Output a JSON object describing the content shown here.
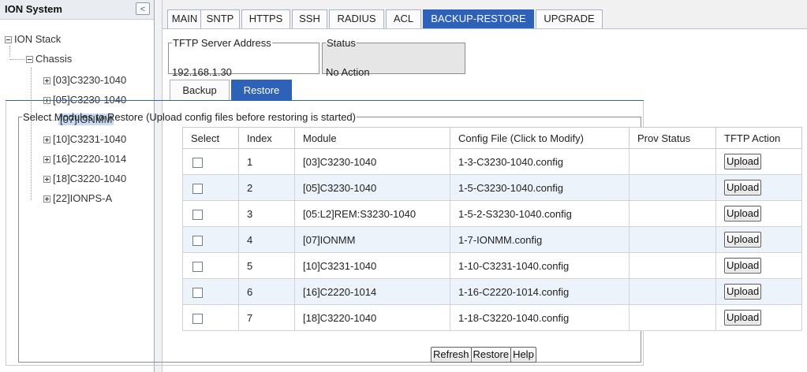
{
  "tree": {
    "title": "ION System",
    "collapse_glyph": "<",
    "root": "ION Stack",
    "chassis": "Chassis",
    "items": [
      {
        "label": "[03]C3230-1040",
        "expandable": true
      },
      {
        "label": "[05]C3230-1040",
        "expandable": true
      },
      {
        "label": "[07]IONMM",
        "expandable": false,
        "selected": true
      },
      {
        "label": "[10]C3231-1040",
        "expandable": true
      },
      {
        "label": "[16]C2220-1014",
        "expandable": true
      },
      {
        "label": "[18]C3220-1040",
        "expandable": true
      },
      {
        "label": "[22]IONPS-A",
        "expandable": true
      }
    ]
  },
  "tabs": [
    {
      "label": "MAIN"
    },
    {
      "label": "SNTP"
    },
    {
      "label": "HTTPS"
    },
    {
      "label": "SSH"
    },
    {
      "label": "RADIUS"
    },
    {
      "label": "ACL"
    },
    {
      "label": "BACKUP-RESTORE",
      "active": true
    },
    {
      "label": "UPGRADE"
    }
  ],
  "tftp": {
    "label": "TFTP Server Address",
    "value": "192.168.1.30"
  },
  "status": {
    "label": "Status",
    "value": "No Action"
  },
  "subtabs": [
    {
      "label": "Backup"
    },
    {
      "label": "Restore",
      "active": true
    }
  ],
  "restore": {
    "legend": "Select Modules to Restore (Upload config files before restoring is started)",
    "columns": [
      "Select",
      "Index",
      "Module",
      "Config File (Click to Modify)",
      "Prov Status",
      "TFTP Action"
    ],
    "rows": [
      {
        "index": "1",
        "module": "[03]C3230-1040",
        "config": "1-3-C3230-1040.config",
        "prov_status": "",
        "action": "Upload"
      },
      {
        "index": "2",
        "module": "[05]C3230-1040",
        "config": "1-5-C3230-1040.config",
        "prov_status": "",
        "action": "Upload"
      },
      {
        "index": "3",
        "module": "[05:L2]REM:S3230-1040",
        "config": "1-5-2-S3230-1040.config",
        "prov_status": "",
        "action": "Upload"
      },
      {
        "index": "4",
        "module": "[07]IONMM",
        "config": "1-7-IONMM.config",
        "prov_status": "",
        "action": "Upload"
      },
      {
        "index": "5",
        "module": "[10]C3231-1040",
        "config": "1-10-C3231-1040.config",
        "prov_status": "",
        "action": "Upload"
      },
      {
        "index": "6",
        "module": "[16]C2220-1014",
        "config": "1-16-C2220-1014.config",
        "prov_status": "",
        "action": "Upload"
      },
      {
        "index": "7",
        "module": "[18]C3220-1040",
        "config": "1-18-C3220-1040.config",
        "prov_status": "",
        "action": "Upload"
      }
    ],
    "buttons": {
      "refresh": "Refresh",
      "restore": "Restore",
      "help": "Help"
    }
  },
  "colors": {
    "accent": "#2e62b8",
    "row_alt": "#edf3fb"
  }
}
